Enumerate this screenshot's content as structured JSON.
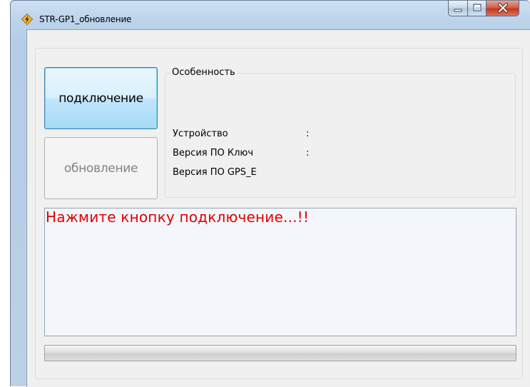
{
  "window": {
    "title": "STR-GP1_обновление"
  },
  "buttons": {
    "connect_label": "подключение",
    "update_label": "обновление"
  },
  "info": {
    "group_title": "Особенность",
    "device_label": "Устройство",
    "device_colon": ":",
    "key_version_label": "Версия ПО Ключ",
    "key_version_colon": ":",
    "gps_version_label": "Версия ПО GPS_E"
  },
  "log": {
    "message": "Нажмите кнопку подключение...!!",
    "message_color": "#e00000"
  },
  "progress": {
    "value_percent": 0
  },
  "icons": {
    "app": "lightning-diamond-icon",
    "minimize": "minimize-icon",
    "maximize": "maximize-icon",
    "close": "close-icon"
  }
}
